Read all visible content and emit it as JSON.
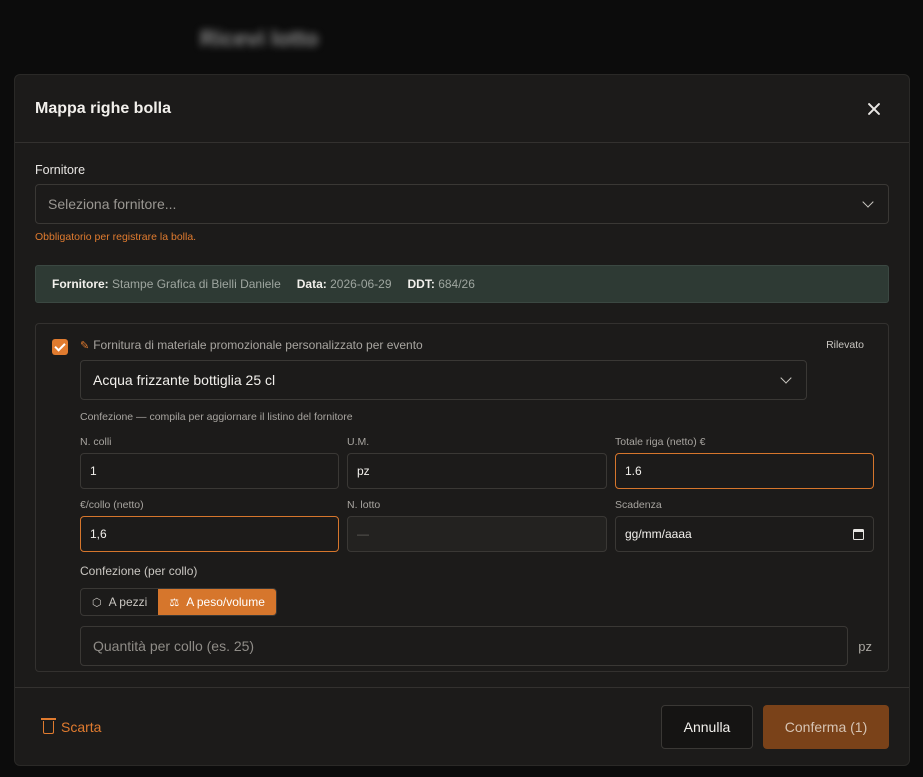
{
  "background": {
    "title": "Ricevi lotto"
  },
  "modal": {
    "title": "Mappa righe bolla",
    "supplier": {
      "label": "Fornitore",
      "placeholder": "Seleziona fornitore...",
      "error": "Obbligatorio per registrare la bolla."
    },
    "info": {
      "supplier_key": "Fornitore:",
      "supplier_value": "Stampe Grafica di Bielli Daniele",
      "date_key": "Data:",
      "date_value": "2026-06-29",
      "ddt_key": "DDT:",
      "ddt_value": "684/26"
    },
    "line": {
      "checked": true,
      "description": "Fornitura di materiale promozionale personalizzato per evento",
      "status": "Rilevato",
      "product": "Acqua frizzante bottiglia 25 cl",
      "hint": "Confezione — compila per aggiornare il listino del fornitore",
      "fields": {
        "colli_label": "N. colli",
        "colli_value": "1",
        "um_label": "U.M.",
        "um_value": "pz",
        "totale_label": "Totale riga (netto) €",
        "totale_value": "1.6",
        "prezzo_label": "€/collo (netto)",
        "prezzo_value": "1,6",
        "lotto_label": "N. lotto",
        "lotto_value": "—",
        "scadenza_label": "Scadenza",
        "scadenza_value": "gg/mm/aaaa"
      },
      "packaging": {
        "label": "Confezione (per collo)",
        "option_pieces": "A pezzi",
        "option_weight": "A peso/volume",
        "selected": "A peso/volume",
        "qty_placeholder": "Quantità per collo (es. 25)",
        "unit": "pz"
      }
    },
    "footer": {
      "discard": "Scarta",
      "cancel": "Annulla",
      "confirm": "Conferma (1)"
    }
  },
  "colors": {
    "accent": "#e07b2f",
    "info_bar": "#2e3a34",
    "confirm_bg": "#7a4219"
  }
}
